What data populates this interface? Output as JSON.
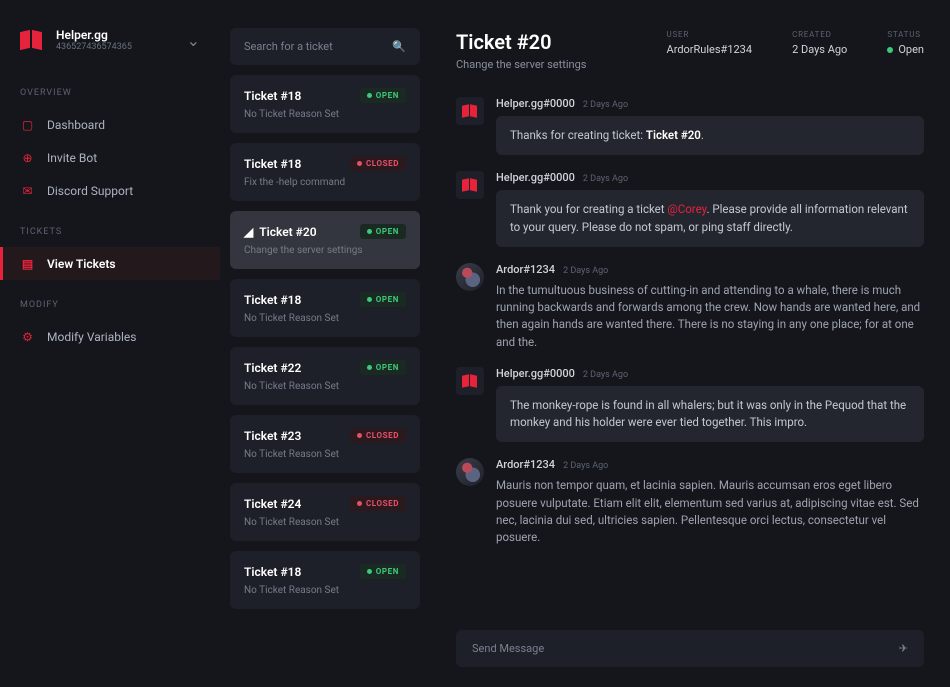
{
  "brand": {
    "name": "Helper.gg",
    "id": "436527436574365"
  },
  "nav": {
    "section_overview": "OVERVIEW",
    "dashboard": "Dashboard",
    "invite_bot": "Invite Bot",
    "discord_support": "Discord Support",
    "section_tickets": "TICKETS",
    "view_tickets": "View Tickets",
    "section_modify": "MODIFY",
    "modify_variables": "Modify Variables"
  },
  "search": {
    "placeholder": "Search for a ticket"
  },
  "status_labels": {
    "open": "OPEN",
    "closed": "CLOSED"
  },
  "tickets": [
    {
      "title": "Ticket #18",
      "sub": "No Ticket Reason Set",
      "status": "open"
    },
    {
      "title": "Ticket #18",
      "sub": "Fix the -help command",
      "status": "closed"
    },
    {
      "title": "Ticket #20",
      "sub": "Change the server settings",
      "status": "open",
      "active": true,
      "flag": true
    },
    {
      "title": "Ticket #18",
      "sub": "No Ticket Reason Set",
      "status": "open"
    },
    {
      "title": "Ticket #22",
      "sub": "No Ticket Reason Set",
      "status": "open"
    },
    {
      "title": "Ticket #23",
      "sub": "No Ticket Reason Set",
      "status": "closed"
    },
    {
      "title": "Ticket #24",
      "sub": "No Ticket Reason Set",
      "status": "closed"
    },
    {
      "title": "Ticket #18",
      "sub": "No Ticket Reason Set",
      "status": "open"
    }
  ],
  "detail": {
    "title": "Ticket #20",
    "subtitle": "Change the server settings",
    "meta": {
      "user_label": "USER",
      "user_value": "ArdorRules#1234",
      "created_label": "CREATED",
      "created_value": "2 Days Ago",
      "status_label": "STATUS",
      "status_value": "Open"
    }
  },
  "messages": [
    {
      "author": "Helper.gg#0000",
      "time": "2 Days Ago",
      "bot": true,
      "bubble": true,
      "html": "Thanks for creating ticket: <strong>Ticket #20</strong>."
    },
    {
      "author": "Helper.gg#0000",
      "time": "2 Days Ago",
      "bot": true,
      "bubble": true,
      "html": "Thank you for creating a ticket <span class='mention'>@Corey</span>. Please provide all information relevant to your query. Please do not spam, or ping staff directly."
    },
    {
      "author": "Ardor#1234",
      "time": "2 Days Ago",
      "bot": false,
      "bubble": false,
      "html": "In the tumultuous business of cutting-in and attending to a whale, there is much running backwards and forwards among the crew. Now hands are wanted here, and then again hands are wanted there. There is no staying in any one place; for at one and the."
    },
    {
      "author": "Helper.gg#0000",
      "time": "2 Days Ago",
      "bot": true,
      "bubble": true,
      "html": "The monkey-rope is found in all whalers; but it was only in the Pequod that the monkey and his holder were ever tied together. This impro."
    },
    {
      "author": "Ardor#1234",
      "time": "2 Days Ago",
      "bot": false,
      "bubble": false,
      "html": "Mauris non tempor quam, et lacinia sapien. Mauris accumsan eros eget libero posuere vulputate. Etiam elit elit, elementum sed varius at, adipiscing vitae est. Sed nec, lacinia dui sed, ultricies sapien. Pellentesque orci lectus, consectetur vel posuere."
    }
  ],
  "composer": {
    "placeholder": "Send Message"
  }
}
